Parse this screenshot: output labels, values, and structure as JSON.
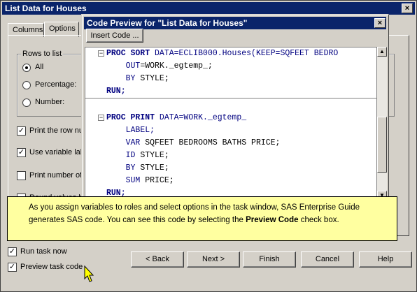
{
  "window": {
    "title": "List Data for Houses"
  },
  "tabs": [
    "Columns",
    "Options"
  ],
  "rows_group": {
    "label": "Rows to list",
    "options": [
      "All",
      "Percentage:",
      "Number:"
    ],
    "selected": "All"
  },
  "checkboxes": [
    {
      "label": "Print the row nu",
      "checked": true
    },
    {
      "label": "Use variable lab",
      "checked": true
    },
    {
      "label": "Print number of r",
      "checked": false
    },
    {
      "label": "Round values b",
      "checked": false
    }
  ],
  "bottom_checks": [
    {
      "label": "Run task now",
      "checked": true
    },
    {
      "label": "Preview task code",
      "checked": true
    }
  ],
  "buttons": [
    "< Back",
    "Next >",
    "Finish",
    "Cancel",
    "Help"
  ],
  "preview": {
    "title": "Code Preview for \"List Data for Houses\"",
    "insert_label": "Insert Code ...",
    "code": [
      {
        "kw": "PROC SORT",
        "rest": " DATA=ECLIB000.Houses(KEEP=SQFEET BEDRO"
      },
      {
        "indent": "    ",
        "kw2": "OUT",
        "rest": "=WORK._egtemp_;"
      },
      {
        "indent": "    ",
        "kw2": "BY",
        "rest": " STYLE;"
      },
      {
        "kw": "RUN;",
        "rest": ""
      },
      {
        "kw": "PROC PRINT",
        "rest": " DATA=WORK._egtemp_"
      },
      {
        "indent": "    ",
        "kw2": "LABEL;",
        "rest": ""
      },
      {
        "indent": "    ",
        "kw2": "VAR",
        "rest": " SQFEET BEDROOMS BATHS PRICE;"
      },
      {
        "indent": "    ",
        "kw2": "ID",
        "rest": " STYLE;"
      },
      {
        "indent": "    ",
        "kw2": "BY",
        "rest": " STYLE;"
      },
      {
        "indent": "    ",
        "kw2": "SUM",
        "rest": " PRICE;"
      },
      {
        "kw": "RUN;",
        "rest": ""
      }
    ]
  },
  "callout": {
    "text_before": "As you assign variables to roles and select options in the task window, SAS Enterprise Guide generates SAS code.  You can see this code by selecting the ",
    "bold": "Preview Code",
    "text_after": " check box."
  }
}
